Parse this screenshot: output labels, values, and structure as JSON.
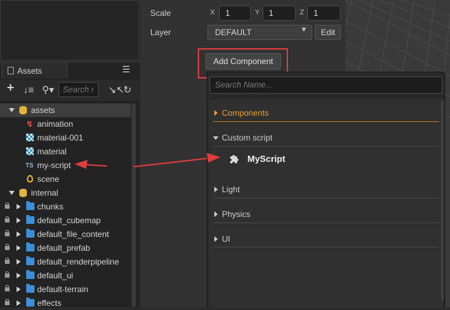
{
  "inspector": {
    "scale_label": "Scale",
    "scale": [
      {
        "axis": "X",
        "value": "1"
      },
      {
        "axis": "Y",
        "value": "1"
      },
      {
        "axis": "Z",
        "value": "1"
      }
    ],
    "layer_label": "Layer",
    "layer_value": "DEFAULT",
    "edit_label": "Edit",
    "add_component_label": "Add Component"
  },
  "assets": {
    "tab_label": "Assets",
    "search_placeholder": "Search r",
    "tree": [
      {
        "label": "assets",
        "type": "db",
        "expanded": true,
        "selected": true
      },
      {
        "label": "animation",
        "type": "anim"
      },
      {
        "label": "material-001",
        "type": "mat"
      },
      {
        "label": "material",
        "type": "mat"
      },
      {
        "label": "my-script",
        "type": "ts",
        "ts_badge": "TS"
      },
      {
        "label": "scene",
        "type": "scene"
      },
      {
        "label": "internal",
        "type": "db",
        "expanded": true
      },
      {
        "label": "chunks",
        "type": "folder"
      },
      {
        "label": "default_cubemap",
        "type": "folder"
      },
      {
        "label": "default_file_content",
        "type": "folder"
      },
      {
        "label": "default_prefab",
        "type": "folder"
      },
      {
        "label": "default_renderpipeline",
        "type": "folder"
      },
      {
        "label": "default_ui",
        "type": "folder"
      },
      {
        "label": "default-terrain",
        "type": "folder"
      },
      {
        "label": "effects",
        "type": "folder"
      }
    ]
  },
  "add_component_popup": {
    "search_placeholder": "Search Name...",
    "categories": {
      "components": "Components",
      "custom_script": "Custom script",
      "light": "Light",
      "physics": "Physics",
      "ui": "UI"
    },
    "myscript_label": "MyScript"
  },
  "colors": {
    "accent_orange": "#f0a030",
    "highlight_red": "#e03c3c",
    "folder_blue": "#3c8fd8"
  }
}
